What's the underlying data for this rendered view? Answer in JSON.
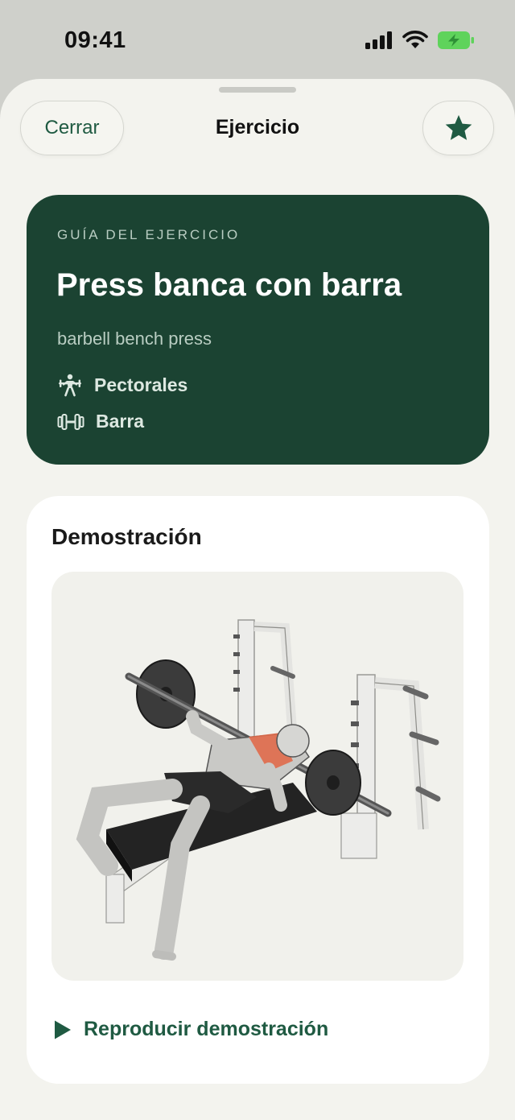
{
  "status": {
    "time": "09:41"
  },
  "header": {
    "close_label": "Cerrar",
    "title": "Ejercicio",
    "favorite_icon": "star-icon"
  },
  "guide": {
    "eyebrow": "GUÍA DEL EJERCICIO",
    "title": "Press banca con barra",
    "subtitle": "barbell bench press",
    "muscle": "Pectorales",
    "muscle_icon": "weightlifter-icon",
    "equipment": "Barra",
    "equipment_icon": "dumbbell-icon"
  },
  "demo": {
    "title": "Demostración",
    "image": "bench-press-illustration",
    "play_label": "Reproducir demostración",
    "play_icon": "play-icon"
  },
  "colors": {
    "accent": "#1f5a42",
    "card_dark": "#1b4332",
    "highlight_muscle": "#e06a4a",
    "battery": "#5fd35b"
  }
}
